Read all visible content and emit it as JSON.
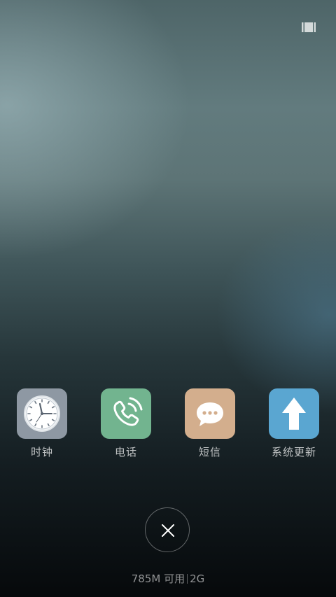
{
  "apps": [
    {
      "label": "时钟",
      "icon": "clock-icon",
      "color": "#8e98a3"
    },
    {
      "label": "电话",
      "icon": "phone-icon",
      "color": "#72b48f"
    },
    {
      "label": "短信",
      "icon": "message-icon",
      "color": "#d3ae8d"
    },
    {
      "label": "系统更新",
      "icon": "update-arrow-icon",
      "color": "#5aa6d1"
    }
  ],
  "memory": {
    "available": "785M 可用",
    "total": "2G"
  },
  "close_icon": "close-icon",
  "view_switch_icon": "view-switch-icon"
}
